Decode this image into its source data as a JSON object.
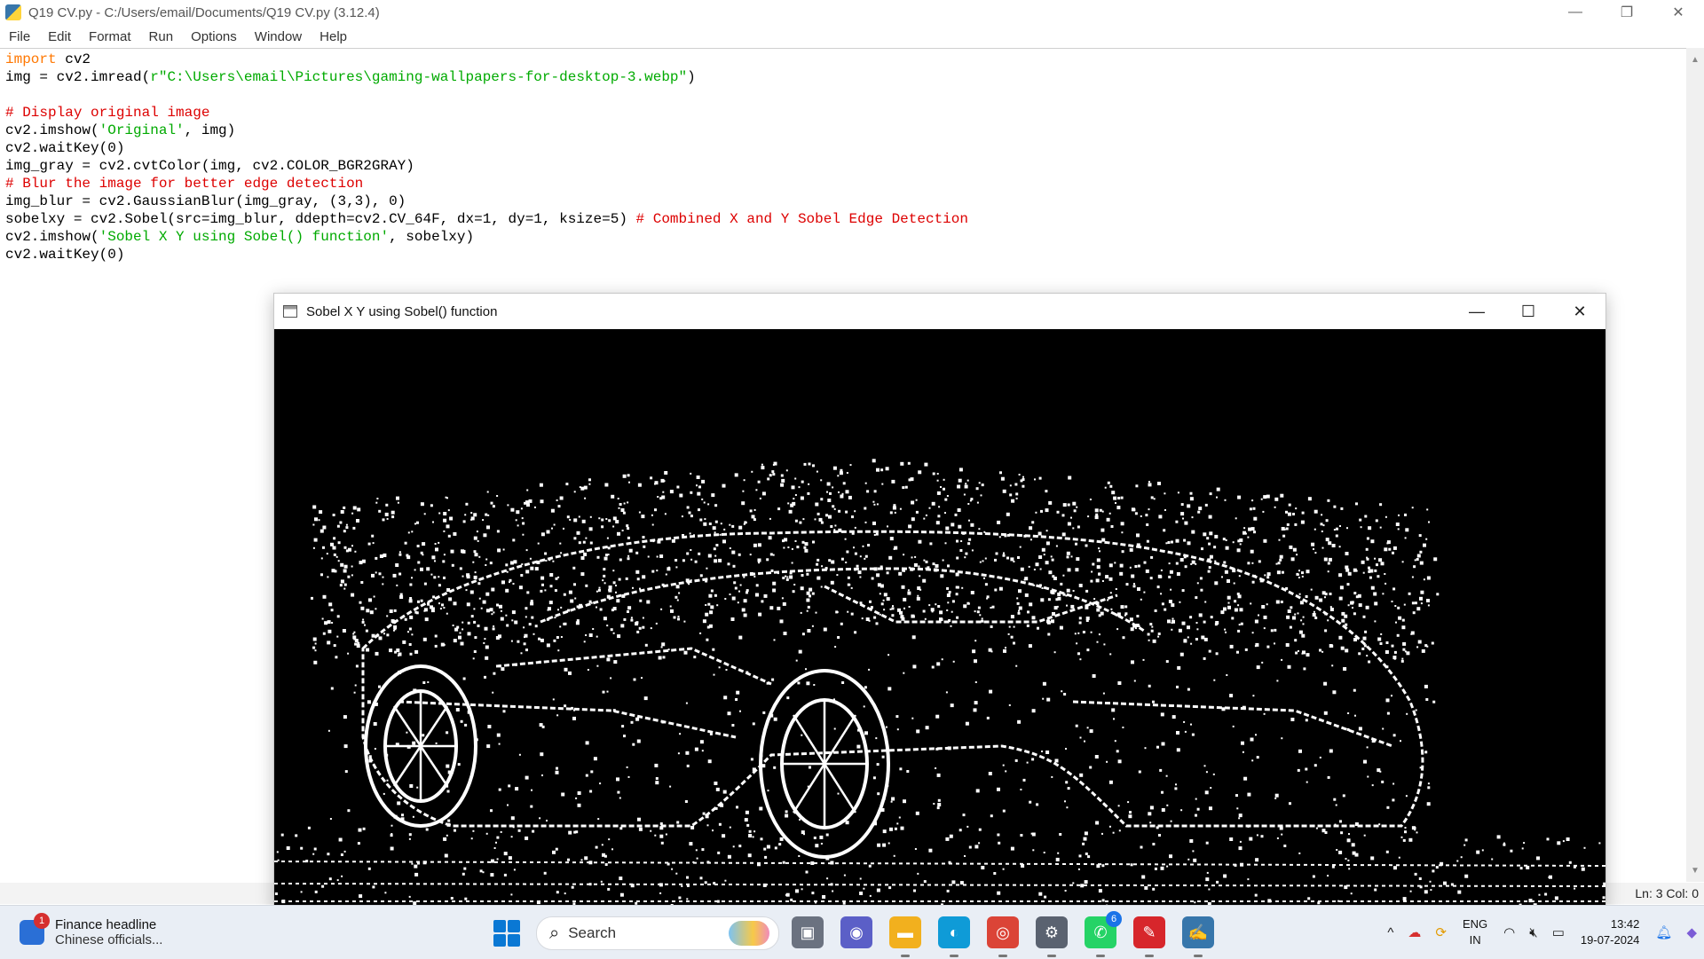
{
  "idle": {
    "title": "Q19 CV.py - C:/Users/email/Documents/Q19 CV.py (3.12.4)",
    "controls": {
      "minimize": "—",
      "restore": "❐",
      "close": "✕"
    },
    "menu": [
      "File",
      "Edit",
      "Format",
      "Run",
      "Options",
      "Window",
      "Help"
    ],
    "status": {
      "position": "Ln: 3   Col: 0"
    }
  },
  "code_lines": [
    [
      {
        "t": "import",
        "c": "kw"
      },
      {
        "t": " cv2",
        "c": ""
      }
    ],
    [
      {
        "t": "img = cv2.imread(",
        "c": ""
      },
      {
        "t": "r\"C:\\Users\\email\\Pictures\\gaming-wallpapers-for-desktop-3.webp\"",
        "c": "str"
      },
      {
        "t": ")",
        "c": ""
      }
    ],
    [],
    [
      {
        "t": "# Display original image",
        "c": "cm"
      }
    ],
    [
      {
        "t": "cv2.imshow(",
        "c": ""
      },
      {
        "t": "'Original'",
        "c": "str"
      },
      {
        "t": ", img)",
        "c": ""
      }
    ],
    [
      {
        "t": "cv2.waitKey(0)",
        "c": ""
      }
    ],
    [
      {
        "t": "img_gray = cv2.cvtColor(img, cv2.COLOR_BGR2GRAY)",
        "c": ""
      }
    ],
    [
      {
        "t": "# Blur the image for better edge detection",
        "c": "cm"
      }
    ],
    [
      {
        "t": "img_blur = cv2.GaussianBlur(img_gray, (3,3), 0)",
        "c": ""
      }
    ],
    [
      {
        "t": "sobelxy = cv2.Sobel(src=img_blur, ddepth=cv2.CV_64F, dx=1, dy=1, ksize=5) ",
        "c": ""
      },
      {
        "t": "# Combined X and Y Sobel Edge Detection",
        "c": "cm"
      }
    ],
    [
      {
        "t": "cv2.imshow(",
        "c": ""
      },
      {
        "t": "'Sobel X Y using Sobel() function'",
        "c": "str"
      },
      {
        "t": ", sobelxy)",
        "c": ""
      }
    ],
    [
      {
        "t": "cv2.waitKey(0)",
        "c": ""
      }
    ]
  ],
  "cv_window": {
    "title": "Sobel X Y using Sobel() function",
    "controls": {
      "minimize": "—",
      "maximize": "☐",
      "close": "✕"
    },
    "image_description_icon": "sobel-edge-car-image"
  },
  "taskbar": {
    "news": {
      "badge": "1",
      "headline": "Finance headline",
      "sub": "Chinese officials..."
    },
    "search_label": "Search",
    "apps": [
      {
        "name": "task-view",
        "glyph": "▣",
        "color": "#6b7280"
      },
      {
        "name": "teams",
        "glyph": "◉",
        "color": "#5b5fc7"
      },
      {
        "name": "file-explorer",
        "glyph": "▬",
        "color": "#f2b01e"
      },
      {
        "name": "edge",
        "glyph": "◐",
        "color": "#0f9bd7"
      },
      {
        "name": "chrome",
        "glyph": "◎",
        "color": "#db4437"
      },
      {
        "name": "settings",
        "glyph": "⚙",
        "color": "#5a6270"
      },
      {
        "name": "whatsapp",
        "glyph": "✆",
        "color": "#25d366",
        "badge": "6"
      },
      {
        "name": "acrobat",
        "glyph": "✎",
        "color": "#d7262b"
      },
      {
        "name": "idle",
        "glyph": "✍",
        "color": "#3776ab"
      }
    ],
    "tray": {
      "chevron": "^",
      "lang_top": "ENG",
      "lang_bottom": "IN",
      "time": "13:42",
      "date": "19-07-2024"
    }
  }
}
